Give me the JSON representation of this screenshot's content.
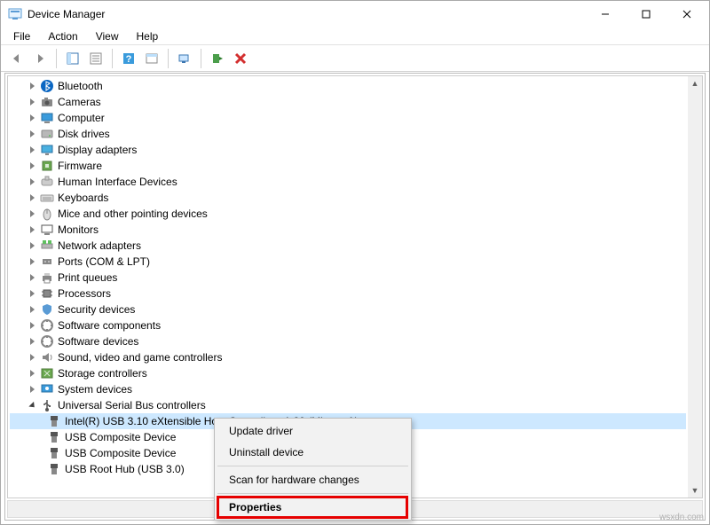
{
  "window": {
    "title": "Device Manager"
  },
  "menu": {
    "file": "File",
    "action": "Action",
    "view": "View",
    "help": "Help"
  },
  "tree": {
    "items": [
      {
        "label": "Bluetooth",
        "icon": "bluetooth"
      },
      {
        "label": "Cameras",
        "icon": "camera"
      },
      {
        "label": "Computer",
        "icon": "computer"
      },
      {
        "label": "Disk drives",
        "icon": "disk"
      },
      {
        "label": "Display adapters",
        "icon": "display"
      },
      {
        "label": "Firmware",
        "icon": "firmware"
      },
      {
        "label": "Human Interface Devices",
        "icon": "hid"
      },
      {
        "label": "Keyboards",
        "icon": "keyboard"
      },
      {
        "label": "Mice and other pointing devices",
        "icon": "mouse"
      },
      {
        "label": "Monitors",
        "icon": "monitor"
      },
      {
        "label": "Network adapters",
        "icon": "network"
      },
      {
        "label": "Ports (COM & LPT)",
        "icon": "port"
      },
      {
        "label": "Print queues",
        "icon": "printer"
      },
      {
        "label": "Processors",
        "icon": "cpu"
      },
      {
        "label": "Security devices",
        "icon": "security"
      },
      {
        "label": "Software components",
        "icon": "software"
      },
      {
        "label": "Software devices",
        "icon": "software"
      },
      {
        "label": "Sound, video and game controllers",
        "icon": "sound"
      },
      {
        "label": "Storage controllers",
        "icon": "storage"
      },
      {
        "label": "System devices",
        "icon": "system"
      }
    ],
    "usb_category": "Universal Serial Bus controllers",
    "usb_children": [
      "Intel(R) USB 3.10 eXtensible Host Controller - 1.20 (Microsoft)",
      "USB Composite Device",
      "USB Composite Device",
      "USB Root Hub (USB 3.0)"
    ]
  },
  "context_menu": {
    "update": "Update driver",
    "uninstall": "Uninstall device",
    "scan": "Scan for hardware changes",
    "properties": "Properties"
  },
  "watermark": "wsxdn.com"
}
